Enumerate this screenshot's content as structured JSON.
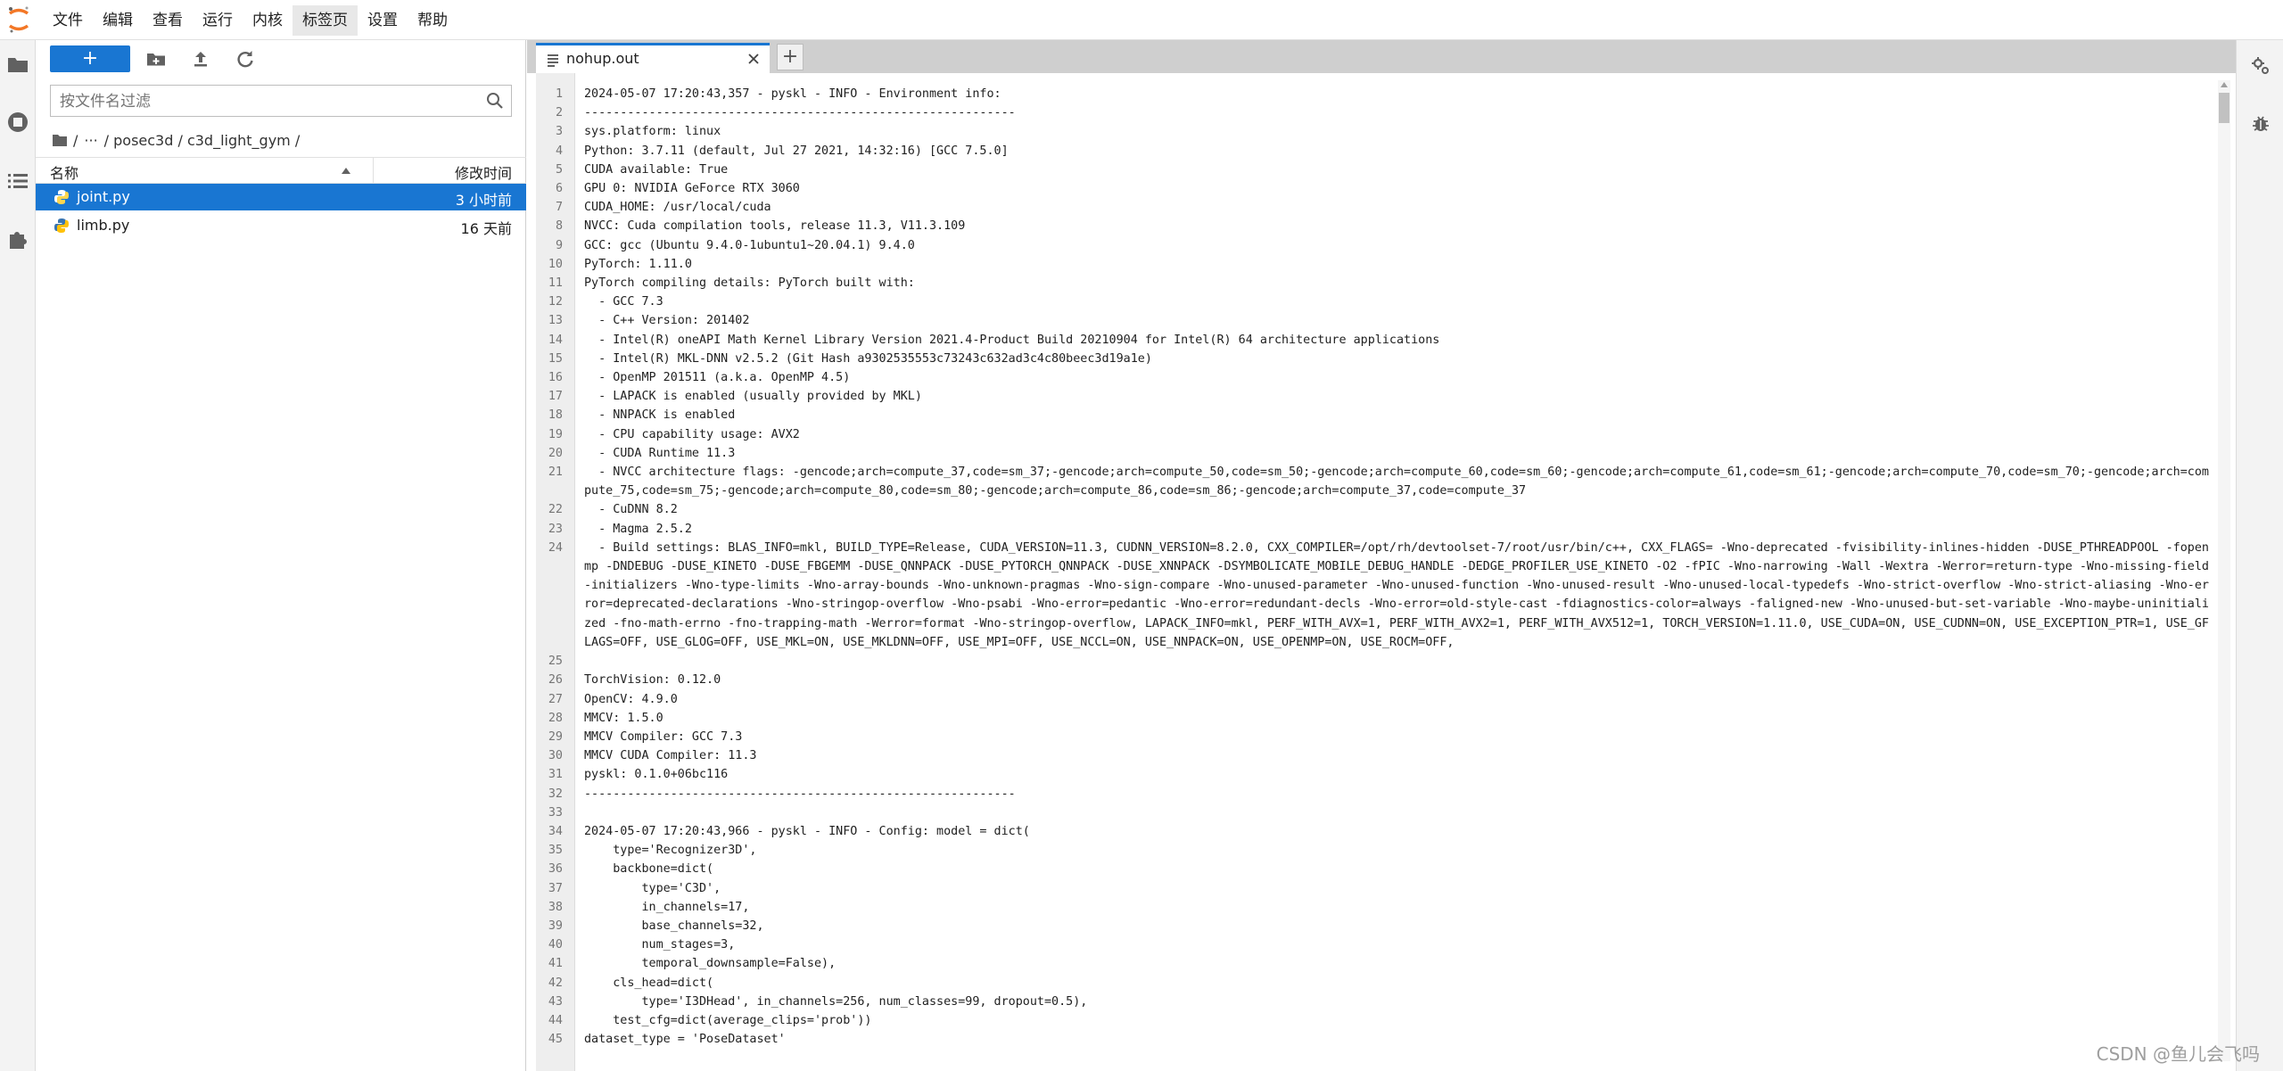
{
  "menubar": {
    "items": [
      "文件",
      "编辑",
      "查看",
      "运行",
      "内核",
      "标签页",
      "设置",
      "帮助"
    ],
    "active_index": 5
  },
  "filebrowser": {
    "new_label": "+",
    "search_placeholder": "按文件名过滤",
    "breadcrumb": [
      "/",
      "···",
      "/ posec3d / c3d_light_gym /"
    ],
    "columns": {
      "name": "名称",
      "modified": "修改时间"
    },
    "files": [
      {
        "name": "joint.py",
        "modified": "3 小时前",
        "selected": true
      },
      {
        "name": "limb.py",
        "modified": "16 天前",
        "selected": false
      }
    ]
  },
  "editor": {
    "tab_label": "nohup.out",
    "add_tab_label": "+",
    "lines": [
      "2024-05-07 17:20:43,357 - pyskl - INFO - Environment info:",
      "------------------------------------------------------------",
      "sys.platform: linux",
      "Python: 3.7.11 (default, Jul 27 2021, 14:32:16) [GCC 7.5.0]",
      "CUDA available: True",
      "GPU 0: NVIDIA GeForce RTX 3060",
      "CUDA_HOME: /usr/local/cuda",
      "NVCC: Cuda compilation tools, release 11.3, V11.3.109",
      "GCC: gcc (Ubuntu 9.4.0-1ubuntu1~20.04.1) 9.4.0",
      "PyTorch: 1.11.0",
      "PyTorch compiling details: PyTorch built with:",
      "  - GCC 7.3",
      "  - C++ Version: 201402",
      "  - Intel(R) oneAPI Math Kernel Library Version 2021.4-Product Build 20210904 for Intel(R) 64 architecture applications",
      "  - Intel(R) MKL-DNN v2.5.2 (Git Hash a9302535553c73243c632ad3c4c80beec3d19a1e)",
      "  - OpenMP 201511 (a.k.a. OpenMP 4.5)",
      "  - LAPACK is enabled (usually provided by MKL)",
      "  - NNPACK is enabled",
      "  - CPU capability usage: AVX2",
      "  - CUDA Runtime 11.3",
      "  - NVCC architecture flags: -gencode;arch=compute_37,code=sm_37;-gencode;arch=compute_50,code=sm_50;-gencode;arch=compute_60,code=sm_60;-gencode;arch=compute_61,code=sm_61;-gencode;arch=compute_70,code=sm_70;-gencode;arch=compute_75,code=sm_75;-gencode;arch=compute_80,code=sm_80;-gencode;arch=compute_86,code=sm_86;-gencode;arch=compute_37,code=compute_37",
      "  - CuDNN 8.2",
      "  - Magma 2.5.2",
      "  - Build settings: BLAS_INFO=mkl, BUILD_TYPE=Release, CUDA_VERSION=11.3, CUDNN_VERSION=8.2.0, CXX_COMPILER=/opt/rh/devtoolset-7/root/usr/bin/c++, CXX_FLAGS= -Wno-deprecated -fvisibility-inlines-hidden -DUSE_PTHREADPOOL -fopenmp -DNDEBUG -DUSE_KINETO -DUSE_FBGEMM -DUSE_QNNPACK -DUSE_PYTORCH_QNNPACK -DUSE_XNNPACK -DSYMBOLICATE_MOBILE_DEBUG_HANDLE -DEDGE_PROFILER_USE_KINETO -O2 -fPIC -Wno-narrowing -Wall -Wextra -Werror=return-type -Wno-missing-field-initializers -Wno-type-limits -Wno-array-bounds -Wno-unknown-pragmas -Wno-sign-compare -Wno-unused-parameter -Wno-unused-function -Wno-unused-result -Wno-unused-local-typedefs -Wno-strict-overflow -Wno-strict-aliasing -Wno-error=deprecated-declarations -Wno-stringop-overflow -Wno-psabi -Wno-error=pedantic -Wno-error=redundant-decls -Wno-error=old-style-cast -fdiagnostics-color=always -faligned-new -Wno-unused-but-set-variable -Wno-maybe-uninitialized -fno-math-errno -fno-trapping-math -Werror=format -Wno-stringop-overflow, LAPACK_INFO=mkl, PERF_WITH_AVX=1, PERF_WITH_AVX2=1, PERF_WITH_AVX512=1, TORCH_VERSION=1.11.0, USE_CUDA=ON, USE_CUDNN=ON, USE_EXCEPTION_PTR=1, USE_GFLAGS=OFF, USE_GLOG=OFF, USE_MKL=ON, USE_MKLDNN=OFF, USE_MPI=OFF, USE_NCCL=ON, USE_NNPACK=ON, USE_OPENMP=ON, USE_ROCM=OFF,",
      "",
      "TorchVision: 0.12.0",
      "OpenCV: 4.9.0",
      "MMCV: 1.5.0",
      "MMCV Compiler: GCC 7.3",
      "MMCV CUDA Compiler: 11.3",
      "pyskl: 0.1.0+06bc116",
      "------------------------------------------------------------",
      "",
      "2024-05-07 17:20:43,966 - pyskl - INFO - Config: model = dict(",
      "    type='Recognizer3D',",
      "    backbone=dict(",
      "        type='C3D',",
      "        in_channels=17,",
      "        base_channels=32,",
      "        num_stages=3,",
      "        temporal_downsample=False),",
      "    cls_head=dict(",
      "        type='I3DHead', in_channels=256, num_classes=99, dropout=0.5),",
      "    test_cfg=dict(average_clips='prob'))",
      "dataset_type = 'PoseDataset'"
    ]
  },
  "watermark": "CSDN @鱼儿会飞吗",
  "icons": {
    "left": [
      "folder-icon",
      "running-icon",
      "toc-icon",
      "extension-icon"
    ],
    "right": [
      "property-inspector-icon",
      "debugger-icon"
    ]
  },
  "colors": {
    "accent": "#1976d2",
    "selected_text": "#ffffff"
  }
}
